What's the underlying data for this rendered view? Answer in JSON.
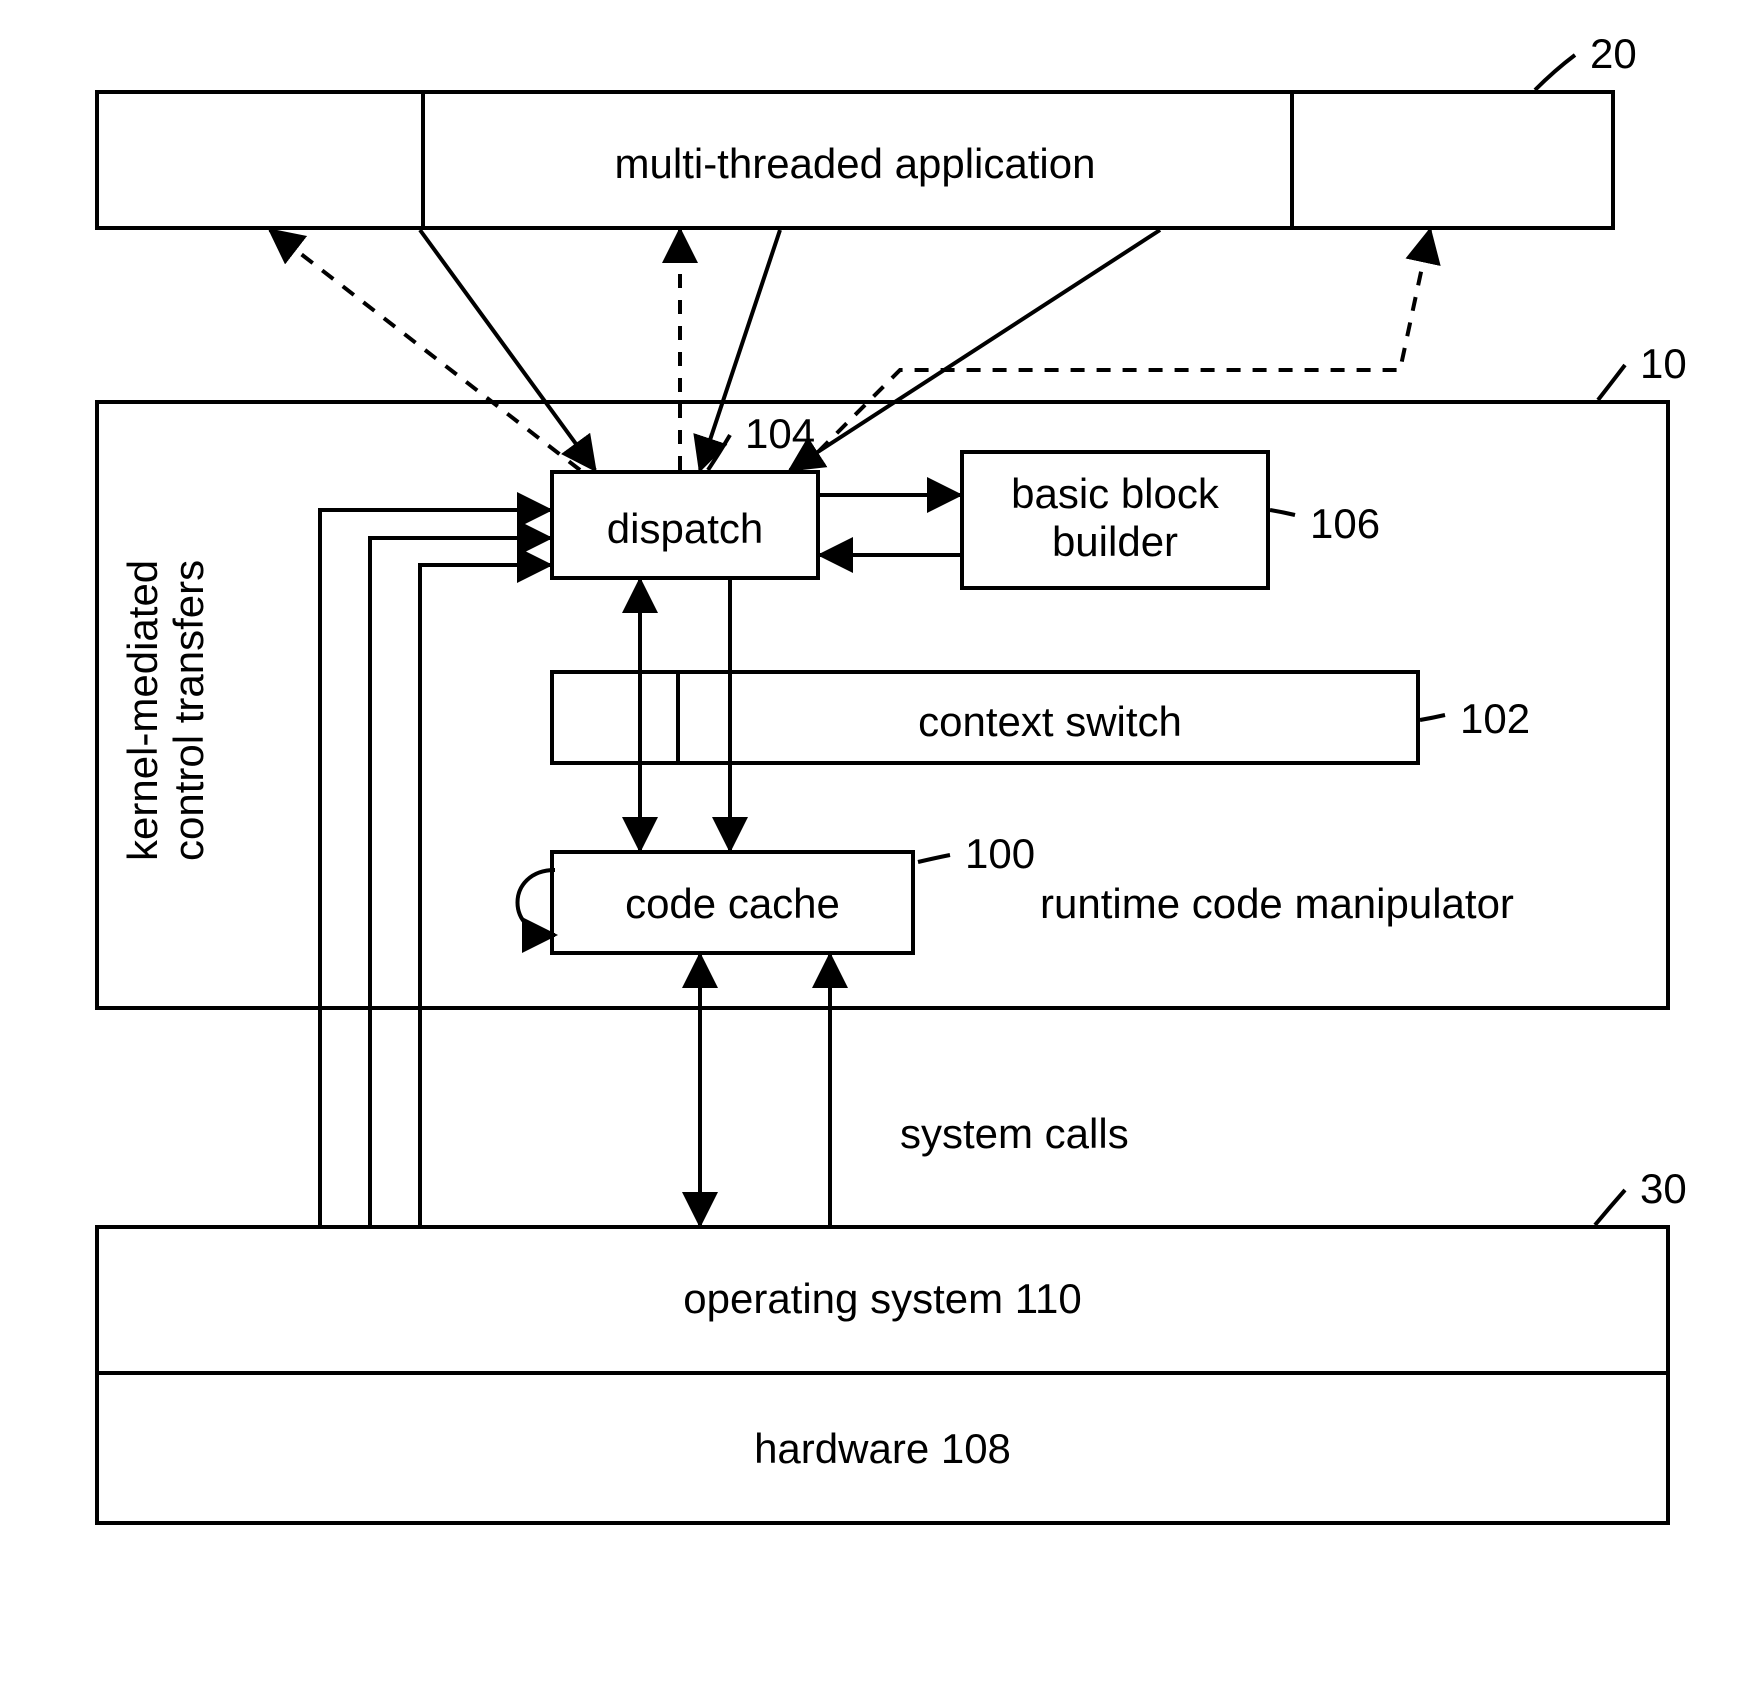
{
  "boxes": {
    "app": {
      "label": "multi-threaded application",
      "ref": "20"
    },
    "runtime": {
      "ref": "10",
      "caption": "runtime code manipulator"
    },
    "dispatch": {
      "label": "dispatch",
      "ref": "104"
    },
    "builder": {
      "label": "basic block\nbuilder",
      "ref": "106"
    },
    "context": {
      "label": "context switch",
      "ref": "102"
    },
    "cache": {
      "label": "code cache",
      "ref": "100"
    },
    "os": {
      "label": "operating system 110",
      "ref": "30"
    },
    "hw": {
      "label": "hardware 108"
    }
  },
  "sidelabel": "kernel-mediated\ncontrol transfers",
  "syscalls": "system calls"
}
